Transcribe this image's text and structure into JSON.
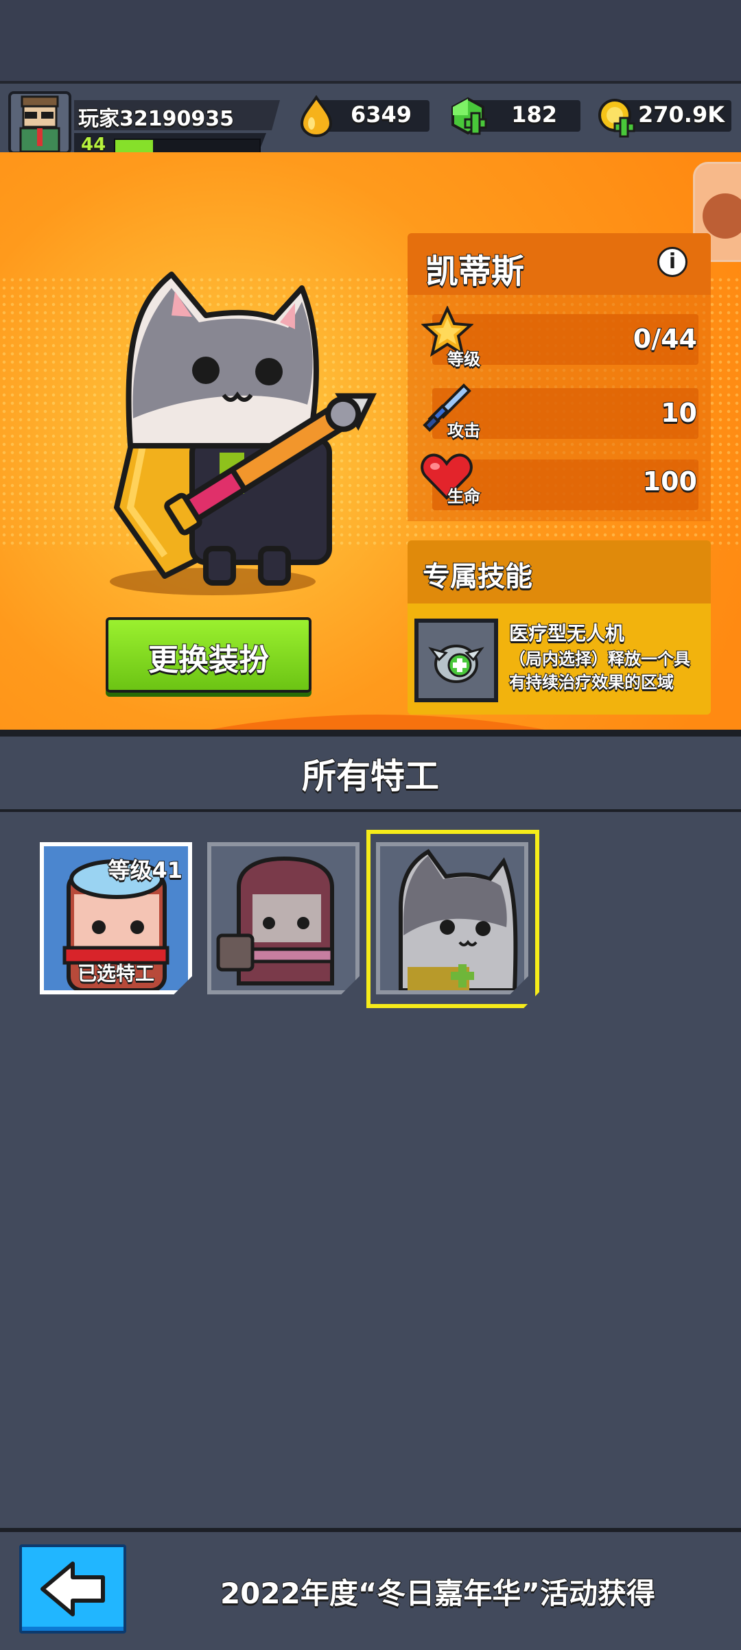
{
  "player": {
    "name": "玩家32190935",
    "level": "44",
    "xp_fraction": 0.26
  },
  "currency": {
    "fuel": "6349",
    "gems": "182",
    "coins": "270.9K"
  },
  "hero": {
    "name": "凯蒂斯",
    "skin_button": "更换装扮"
  },
  "stats": {
    "level": {
      "tag": "等级",
      "value": "0/44"
    },
    "attack": {
      "tag": "攻击",
      "value": "10"
    },
    "health": {
      "tag": "生命",
      "value": "100"
    }
  },
  "skill": {
    "section_title": "专属技能",
    "name": "医疗型无人机",
    "description": "（局内选择）释放一个具有持续治疗效果的区域"
  },
  "agents": {
    "title": "所有特工",
    "items": [
      {
        "level_label": "等级41",
        "badge": "已选特工"
      },
      {
        "level_label": "",
        "badge": ""
      },
      {
        "level_label": "",
        "badge": ""
      }
    ]
  },
  "footer": {
    "text": "2022年度“冬日嘉年华”活动获得"
  },
  "colors": {
    "accent_orange": "#ff9a1c",
    "button_green": "#7ed321",
    "selection_yellow": "#f6ec1a",
    "back_blue": "#21b6ff"
  }
}
